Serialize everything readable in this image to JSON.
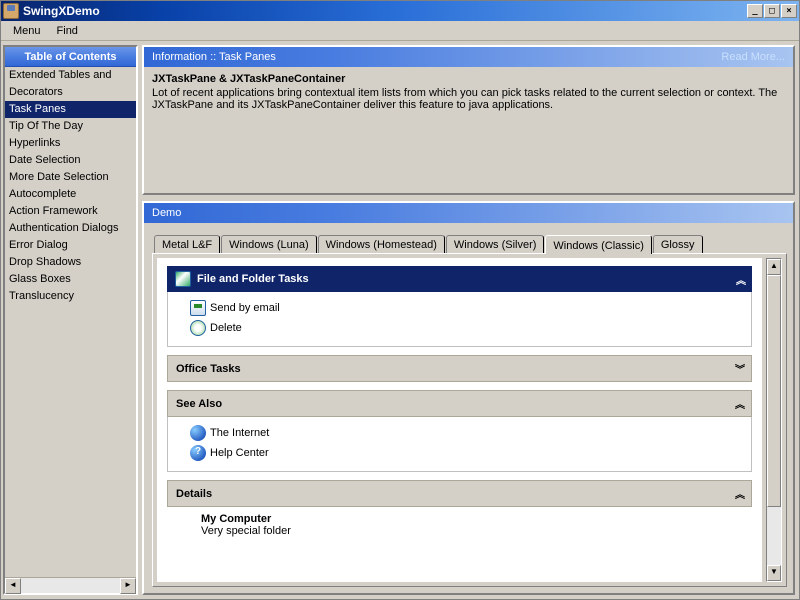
{
  "window": {
    "title": "SwingXDemo"
  },
  "menubar": {
    "items": [
      "Menu",
      "Find"
    ]
  },
  "sidebar": {
    "header": "Table of Contents",
    "items": [
      "Extended Tables and",
      "Decorators",
      "Task Panes",
      "Tip Of The Day",
      "Hyperlinks",
      "Date Selection",
      "More Date Selection",
      "Autocomplete",
      "Action Framework",
      "Authentication Dialogs",
      "Error Dialog",
      "Drop Shadows",
      "Glass Boxes",
      "Translucency"
    ],
    "selected_index": 2
  },
  "info": {
    "header": "Information :: Task Panes",
    "read_more": "Read More...",
    "title": "JXTaskPane & JXTaskPaneContainer",
    "body": "Lot of recent applications bring contextual item lists from which you can pick tasks related to the current selection or context. The JXTaskPane and its JXTaskPaneContainer deliver this feature to java applications."
  },
  "demo": {
    "header": "Demo",
    "tabs": [
      "Metal L&F",
      "Windows (Luna)",
      "Windows (Homestead)",
      "Windows (Silver)",
      "Windows (Classic)",
      "Glossy"
    ],
    "active_tab_index": 4,
    "taskgroups": [
      {
        "title": "File and Folder Tasks",
        "style": "primary",
        "expanded": true,
        "has_icon": true,
        "links": [
          {
            "label": "Send by email",
            "icon": "mail-icon"
          },
          {
            "label": "Delete",
            "icon": "delete-icon"
          }
        ]
      },
      {
        "title": "Office Tasks",
        "style": "secondary",
        "expanded": false
      },
      {
        "title": "See Also",
        "style": "secondary",
        "expanded": true,
        "links": [
          {
            "label": "The Internet",
            "icon": "globe-icon"
          },
          {
            "label": "Help Center",
            "icon": "help-icon"
          }
        ]
      },
      {
        "title": "Details",
        "style": "secondary",
        "expanded": true,
        "detail": {
          "title": "My Computer",
          "subtitle": "Very special folder"
        }
      }
    ]
  }
}
